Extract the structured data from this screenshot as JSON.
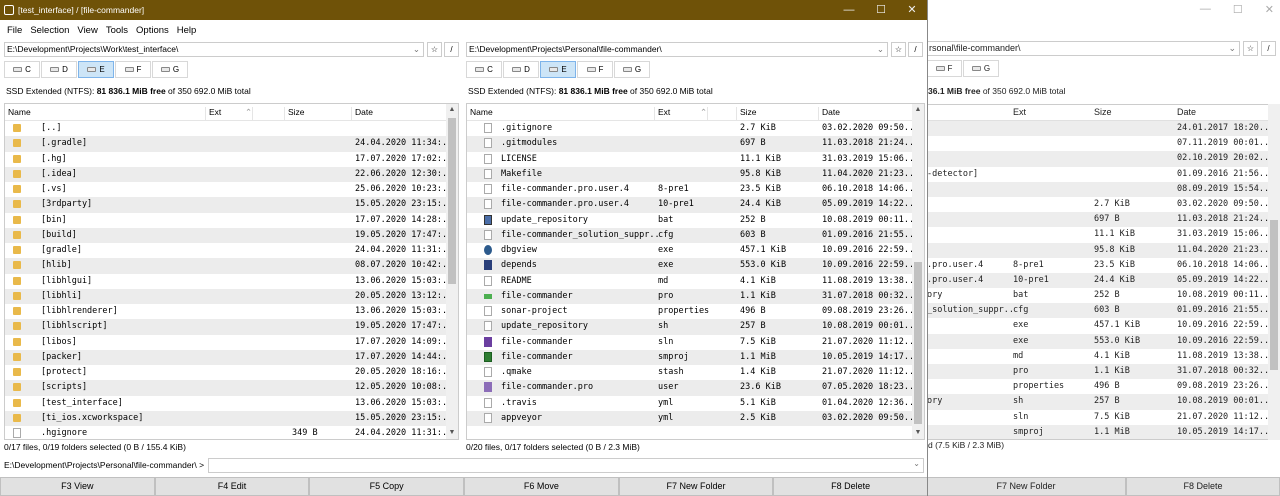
{
  "window": {
    "title": "[test_interface] / [file-commander]",
    "controls": [
      "—",
      "☐",
      "✕"
    ]
  },
  "menu": [
    "File",
    "Selection",
    "View",
    "Tools",
    "Options",
    "Help"
  ],
  "left": {
    "path": "E:\\Development\\Projects\\Work\\test_interface\\",
    "drives": [
      "C",
      "D",
      "E",
      "F",
      "G"
    ],
    "active_drive": "E",
    "free_prefix": "SSD Extended (NTFS): ",
    "free_bold": "81 836.1 MiB free",
    "free_suffix": " of 350 692.0 MiB total",
    "columns": [
      "Name",
      "Ext",
      "Size",
      "Date"
    ],
    "rows": [
      {
        "icon": "folder-icon",
        "name": "[..]",
        "ext": "",
        "size": "",
        "date": ""
      },
      {
        "icon": "folder-icon",
        "name": "[.gradle]",
        "ext": "",
        "size": "",
        "date": "24.04.2020 11:34:.."
      },
      {
        "icon": "folder-icon",
        "name": "[.hg]",
        "ext": "",
        "size": "",
        "date": "17.07.2020 17:02:.."
      },
      {
        "icon": "folder-icon",
        "name": "[.idea]",
        "ext": "",
        "size": "",
        "date": "22.06.2020 12:30:.."
      },
      {
        "icon": "folder-icon",
        "name": "[.vs]",
        "ext": "",
        "size": "",
        "date": "25.06.2020 10:23:.."
      },
      {
        "icon": "folder-icon",
        "name": "[3rdparty]",
        "ext": "",
        "size": "",
        "date": "15.05.2020 23:15:.."
      },
      {
        "icon": "folder-icon",
        "name": "[bin]",
        "ext": "",
        "size": "",
        "date": "17.07.2020 14:28:.."
      },
      {
        "icon": "folder-icon",
        "name": "[build]",
        "ext": "",
        "size": "",
        "date": "19.05.2020 17:47:.."
      },
      {
        "icon": "folder-icon",
        "name": "[gradle]",
        "ext": "",
        "size": "",
        "date": "24.04.2020 11:31:.."
      },
      {
        "icon": "folder-icon",
        "name": "[hlib]",
        "ext": "",
        "size": "",
        "date": "08.07.2020 10:42:.."
      },
      {
        "icon": "folder-icon",
        "name": "[libhlgui]",
        "ext": "",
        "size": "",
        "date": "13.06.2020 15:03:.."
      },
      {
        "icon": "folder-icon",
        "name": "[libhli]",
        "ext": "",
        "size": "",
        "date": "20.05.2020 13:12:.."
      },
      {
        "icon": "folder-icon",
        "name": "[libhlrenderer]",
        "ext": "",
        "size": "",
        "date": "13.06.2020 15:03:.."
      },
      {
        "icon": "folder-icon",
        "name": "[libhlscript]",
        "ext": "",
        "size": "",
        "date": "19.05.2020 17:47:.."
      },
      {
        "icon": "folder-icon",
        "name": "[libos]",
        "ext": "",
        "size": "",
        "date": "17.07.2020 14:09:.."
      },
      {
        "icon": "folder-icon",
        "name": "[packer]",
        "ext": "",
        "size": "",
        "date": "17.07.2020 14:44:.."
      },
      {
        "icon": "folder-icon",
        "name": "[protect]",
        "ext": "",
        "size": "",
        "date": "20.05.2020 18:16:.."
      },
      {
        "icon": "folder-icon",
        "name": "[scripts]",
        "ext": "",
        "size": "",
        "date": "12.05.2020 10:08:.."
      },
      {
        "icon": "folder-icon",
        "name": "[test_interface]",
        "ext": "",
        "size": "",
        "date": "13.06.2020 15:03:.."
      },
      {
        "icon": "folder-icon",
        "name": "[ti_ios.xcworkspace]",
        "ext": "",
        "size": "",
        "date": "15.05.2020 23:15:.."
      },
      {
        "icon": "file-icon",
        "name": ".hgignore",
        "ext": "",
        "size": "349 B",
        "date": "24.04.2020 11:31:.."
      }
    ],
    "status": "0/17 files, 0/19 folders selected (0 B / 155.4 KiB)"
  },
  "right": {
    "path": "E:\\Development\\Projects\\Personal\\file-commander\\",
    "drives": [
      "C",
      "D",
      "E",
      "F",
      "G"
    ],
    "active_drive": "E",
    "free_prefix": "SSD Extended (NTFS): ",
    "free_bold": "81 836.1 MiB free",
    "free_suffix": " of 350 692.0 MiB total",
    "columns": [
      "Name",
      "Ext",
      "Size",
      "Date"
    ],
    "rows": [
      {
        "icon": "file-icon",
        "name": ".gitignore",
        "ext": "",
        "size": "2.7 KiB",
        "date": "03.02.2020 09:50.."
      },
      {
        "icon": "file-icon",
        "name": ".gitmodules",
        "ext": "",
        "size": "697 B",
        "date": "11.03.2018 21:24.."
      },
      {
        "icon": "file-icon",
        "name": "LICENSE",
        "ext": "",
        "size": "11.1 KiB",
        "date": "31.03.2019 15:06.."
      },
      {
        "icon": "file-icon",
        "name": "Makefile",
        "ext": "",
        "size": "95.8 KiB",
        "date": "11.04.2020 21:23.."
      },
      {
        "icon": "file-icon",
        "name": "file-commander.pro.user.4",
        "ext": "8-pre1",
        "size": "23.5 KiB",
        "date": "06.10.2018 14:06.."
      },
      {
        "icon": "file-icon",
        "name": "file-commander.pro.user.4",
        "ext": "10-pre1",
        "size": "24.4 KiB",
        "date": "05.09.2019 14:22.."
      },
      {
        "icon": "script-icon",
        "name": "update_repository",
        "ext": "bat",
        "size": "252 B",
        "date": "10.08.2019 00:11.."
      },
      {
        "icon": "file-icon",
        "name": "file-commander_solution_suppr..",
        "ext": "cfg",
        "size": "603 B",
        "date": "01.09.2016 21:55.."
      },
      {
        "icon": "bug-icon",
        "name": "dbgview",
        "ext": "exe",
        "size": "457.1 KiB",
        "date": "10.09.2016 22:59.."
      },
      {
        "icon": "exe-icon",
        "name": "depends",
        "ext": "exe",
        "size": "553.0 KiB",
        "date": "10.09.2016 22:59.."
      },
      {
        "icon": "file-icon",
        "name": "README",
        "ext": "md",
        "size": "4.1 KiB",
        "date": "11.08.2019 13:38.."
      },
      {
        "icon": "qt-pro-icon",
        "name": "file-commander",
        "ext": "pro",
        "size": "1.1 KiB",
        "date": "31.07.2018 00:32.."
      },
      {
        "icon": "file-icon",
        "name": "sonar-project",
        "ext": "properties",
        "size": "496 B",
        "date": "09.08.2019 23:26.."
      },
      {
        "icon": "file-icon",
        "name": "update_repository",
        "ext": "sh",
        "size": "257 B",
        "date": "10.08.2019 00:01.."
      },
      {
        "icon": "sln-icon",
        "name": "file-commander",
        "ext": "sln",
        "size": "7.5 KiB",
        "date": "21.07.2020 11:12.."
      },
      {
        "icon": "smproj-icon",
        "name": "file-commander",
        "ext": "smproj",
        "size": "1.1 MiB",
        "date": "10.05.2019 14:17.."
      },
      {
        "icon": "file-icon",
        "name": ".qmake",
        "ext": "stash",
        "size": "1.4 KiB",
        "date": "21.07.2020 11:12.."
      },
      {
        "icon": "user-file-icon",
        "name": "file-commander.pro",
        "ext": "user",
        "size": "23.6 KiB",
        "date": "07.05.2020 18:23.."
      },
      {
        "icon": "file-icon",
        "name": ".travis",
        "ext": "yml",
        "size": "5.1 KiB",
        "date": "01.04.2020 12:36.."
      },
      {
        "icon": "file-icon",
        "name": "appveyor",
        "ext": "yml",
        "size": "2.5 KiB",
        "date": "03.02.2020 09:50.."
      }
    ],
    "status": "0/20 files, 0/17 folders selected (0 B / 2.3 MiB)"
  },
  "cmdline": {
    "label": "E:\\Development\\Projects\\Personal\\file-commander\\  >"
  },
  "fkeys": [
    "F3 View",
    "F4 Edit",
    "F5 Copy",
    "F6 Move",
    "F7 New Folder",
    "F8 Delete"
  ],
  "bgwin": {
    "path": "rsonal\\file-commander\\",
    "drives": [
      "F",
      "G"
    ],
    "free_bold": "36.1 MiB free",
    "free_suffix": " of 350 692.0 MiB total",
    "columns": [
      "Ext",
      "Size",
      "Date"
    ],
    "rows": [
      {
        "name": "",
        "ext": "",
        "size": "",
        "date": "24.01.2017 18:20.."
      },
      {
        "name": "",
        "ext": "",
        "size": "",
        "date": "07.11.2019 00:01.."
      },
      {
        "name": "",
        "ext": "",
        "size": "",
        "date": "02.10.2019 20:02.."
      },
      {
        "name": "-detector]",
        "ext": "",
        "size": "",
        "date": "01.09.2016 21:56.."
      },
      {
        "name": "",
        "ext": "",
        "size": "",
        "date": "08.09.2019 15:54.."
      },
      {
        "name": "",
        "ext": "",
        "size": "2.7 KiB",
        "date": "03.02.2020 09:50.."
      },
      {
        "name": "",
        "ext": "",
        "size": "697 B",
        "date": "11.03.2018 21:24.."
      },
      {
        "name": "",
        "ext": "",
        "size": "11.1 KiB",
        "date": "31.03.2019 15:06.."
      },
      {
        "name": "",
        "ext": "",
        "size": "95.8 KiB",
        "date": "11.04.2020 21:23.."
      },
      {
        "name": ".pro.user.4",
        "ext": "8-pre1",
        "size": "23.5 KiB",
        "date": "06.10.2018 14:06.."
      },
      {
        "name": ".pro.user.4",
        "ext": "10-pre1",
        "size": "24.4 KiB",
        "date": "05.09.2019 14:22.."
      },
      {
        "name": "ory",
        "ext": "bat",
        "size": "252 B",
        "date": "10.08.2019 00:11.."
      },
      {
        "name": "_solution_suppr..",
        "ext": "cfg",
        "size": "603 B",
        "date": "01.09.2016 21:55.."
      },
      {
        "name": "",
        "ext": "exe",
        "size": "457.1 KiB",
        "date": "10.09.2016 22:59.."
      },
      {
        "name": "",
        "ext": "exe",
        "size": "553.0 KiB",
        "date": "10.09.2016 22:59.."
      },
      {
        "name": "",
        "ext": "md",
        "size": "4.1 KiB",
        "date": "11.08.2019 13:38.."
      },
      {
        "name": "",
        "ext": "pro",
        "size": "1.1 KiB",
        "date": "31.07.2018 00:32.."
      },
      {
        "name": "",
        "ext": "properties",
        "size": "496 B",
        "date": "09.08.2019 23:26.."
      },
      {
        "name": "ory",
        "ext": "sh",
        "size": "257 B",
        "date": "10.08.2019 00:01.."
      },
      {
        "name": "",
        "ext": "sln",
        "size": "7.5 KiB",
        "date": "21.07.2020 11:12.."
      },
      {
        "name": "",
        "ext": "smproj",
        "size": "1.1 MiB",
        "date": "10.05.2019 14:17.."
      }
    ],
    "status": "d (7.5 KiB / 2.3 MiB)",
    "fkeys": [
      "F7 New Folder",
      "F8 Delete"
    ]
  }
}
